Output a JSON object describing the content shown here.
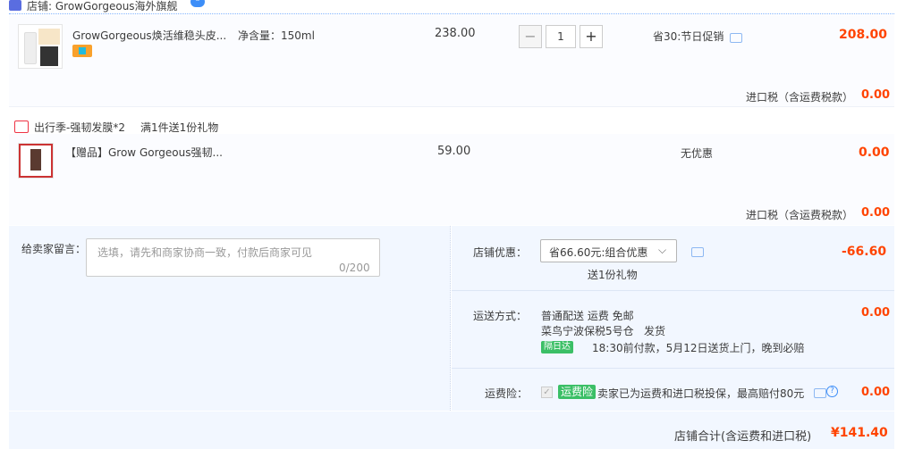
{
  "shop": {
    "label": "店铺: GrowGorgeous海外旗舰",
    "ww_icon": "wangwang-icon"
  },
  "item1": {
    "title": "GrowGorgeous焕活维稳头皮...",
    "spec": "净含量：150ml",
    "price": "238.00",
    "qty": "1",
    "qty_minus": "−",
    "qty_plus": "+",
    "promo": "省30:节日促销",
    "total": "208.00",
    "tax_label": "进口税（含运费税款）",
    "tax_value": "0.00"
  },
  "gift_promo": {
    "title": "出行季-强韧发膜*2",
    "rule": "满1件送1份礼物"
  },
  "item2": {
    "title": "【赠品】Grow Gorgeous强韧...",
    "price": "59.00",
    "promo": "无优惠",
    "total": "0.00",
    "tax_label": "进口税（含运费税款）",
    "tax_value": "0.00"
  },
  "message": {
    "label": "给卖家留言：",
    "placeholder": "选填，请先和商家协商一致，付款后商家可见",
    "counter": "0/200"
  },
  "discount": {
    "label": "店铺优惠：",
    "selected": "省66.60元:组合优惠",
    "gift_note": "送1份礼物",
    "value": "-66.60"
  },
  "shipping": {
    "label": "运送方式：",
    "method": "普通配送 运费 免邮",
    "warehouse": "菜鸟宁波保税5号仓",
    "ship_word": "发货",
    "badge": "隔日达",
    "promise": "18:30前付款，5月12日送货上门，晚到必赔",
    "value": "0.00"
  },
  "insurance": {
    "label": "运费险：",
    "badge": "运费险",
    "desc": "卖家已为运费和进口税投保，最高赔付80元",
    "value": "0.00"
  },
  "summary": {
    "label": "店铺合计(含运费和进口税)",
    "value": "¥141.40"
  },
  "colors": {
    "accent_red": "#ff4400",
    "link_blue": "#3d8ef8",
    "bg_blue": "#f2f7ff"
  }
}
